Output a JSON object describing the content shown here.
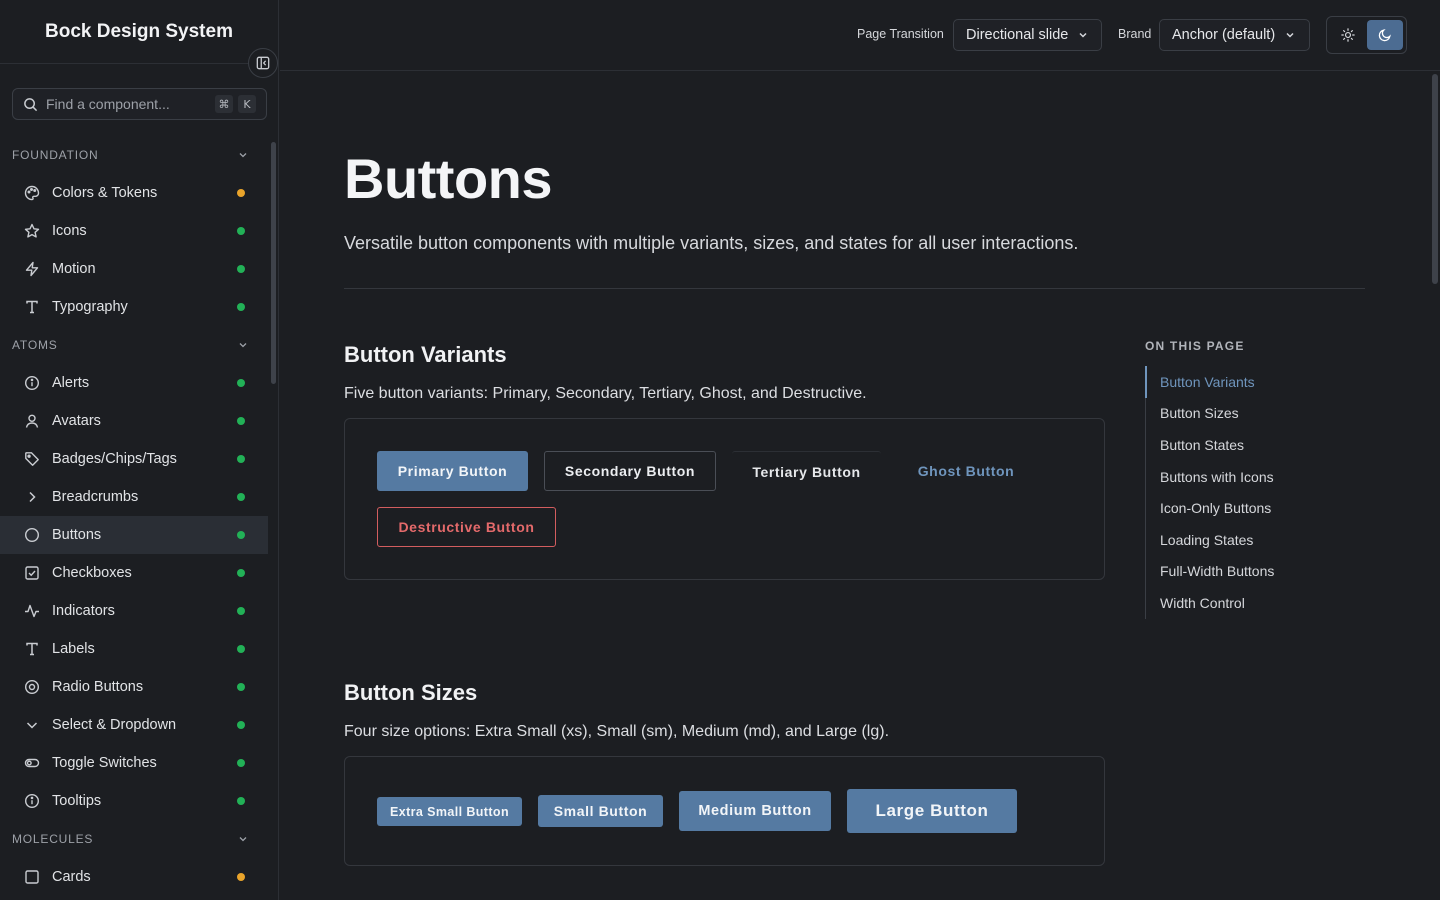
{
  "app": {
    "title": "Bock Design System"
  },
  "search": {
    "placeholder": "Find a component...",
    "shortcut_mod": "⌘",
    "shortcut_key": "K"
  },
  "nav": {
    "groups": [
      {
        "label": "FOUNDATION",
        "items": [
          {
            "label": "Colors & Tokens",
            "icon": "palette-icon",
            "status": "#e9a42b"
          },
          {
            "label": "Icons",
            "icon": "star-icon",
            "status": "#22b157"
          },
          {
            "label": "Motion",
            "icon": "bolt-icon",
            "status": "#22b157"
          },
          {
            "label": "Typography",
            "icon": "type-icon",
            "status": "#22b157"
          }
        ]
      },
      {
        "label": "ATOMS",
        "items": [
          {
            "label": "Alerts",
            "icon": "info-icon",
            "status": "#22b157"
          },
          {
            "label": "Avatars",
            "icon": "user-icon",
            "status": "#22b157"
          },
          {
            "label": "Badges/Chips/Tags",
            "icon": "tag-icon",
            "status": "#22b157"
          },
          {
            "label": "Breadcrumbs",
            "icon": "chevron-right-icon",
            "status": "#22b157"
          },
          {
            "label": "Buttons",
            "icon": "circle-icon",
            "status": "#22b157",
            "active": true
          },
          {
            "label": "Checkboxes",
            "icon": "checkbox-icon",
            "status": "#22b157"
          },
          {
            "label": "Indicators",
            "icon": "activity-icon",
            "status": "#22b157"
          },
          {
            "label": "Labels",
            "icon": "type-icon",
            "status": "#22b157"
          },
          {
            "label": "Radio Buttons",
            "icon": "radio-icon",
            "status": "#22b157"
          },
          {
            "label": "Select & Dropdown",
            "icon": "chevron-down-icon",
            "status": "#22b157"
          },
          {
            "label": "Toggle Switches",
            "icon": "toggle-icon",
            "status": "#22b157"
          },
          {
            "label": "Tooltips",
            "icon": "info-icon",
            "status": "#22b157"
          }
        ]
      },
      {
        "label": "MOLECULES",
        "items": [
          {
            "label": "Cards",
            "icon": "square-icon",
            "status": "#e9a42b"
          }
        ]
      }
    ]
  },
  "topbar": {
    "transition_label": "Page Transition",
    "transition_value": "Directional slide",
    "brand_label": "Brand",
    "brand_value": "Anchor (default)",
    "theme": "dark"
  },
  "page": {
    "title": "Buttons",
    "description": "Versatile button components with multiple variants, sizes, and states for all user interactions."
  },
  "sections": {
    "variants": {
      "title": "Button Variants",
      "description": "Five button variants: Primary, Secondary, Tertiary, Ghost, and Destructive.",
      "buttons": {
        "primary": "Primary Button",
        "secondary": "Secondary Button",
        "tertiary": "Tertiary Button",
        "ghost": "Ghost Button",
        "destructive": "Destructive Button"
      }
    },
    "sizes": {
      "title": "Button Sizes",
      "description": "Four size options: Extra Small (xs), Small (sm), Medium (md), and Large (lg).",
      "buttons": {
        "xs": "Extra Small Button",
        "sm": "Small Button",
        "md": "Medium Button",
        "lg": "Large Button"
      }
    }
  },
  "toc": {
    "heading": "ON THIS PAGE",
    "items": [
      "Button Variants",
      "Button Sizes",
      "Button States",
      "Buttons with Icons",
      "Icon-Only Buttons",
      "Loading States",
      "Full-Width Buttons",
      "Width Control"
    ],
    "active": "Button Variants"
  },
  "colors": {
    "accent": "#557aa2",
    "accent_text": "#6f95bd",
    "destructive": "#e46a6b",
    "status_ok": "#22b157",
    "status_warn": "#e9a42b"
  }
}
